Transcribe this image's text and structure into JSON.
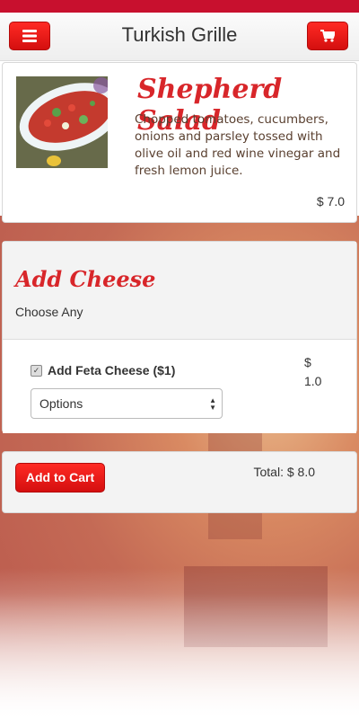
{
  "header": {
    "title": "Turkish Grille",
    "menu_icon": "hamburger-menu-icon",
    "cart_icon": "shopping-cart-icon",
    "accent_color": "#d40f0f"
  },
  "item": {
    "name": "Shepherd Salad",
    "description": "Chopped tomatoes, cucumbers, onions and parsley tossed with olive oil and red wine vinegar and fresh lemon juice.",
    "price": "$ 7.0"
  },
  "options": {
    "title": "Add Cheese",
    "subtitle": "Choose Any",
    "choices": [
      {
        "label": "Add Feta Cheese ($1)",
        "price": "$ 1.0",
        "checked": true,
        "select_value": "Options"
      }
    ]
  },
  "cart": {
    "add_button": "Add to Cart",
    "total": "Total: $ 8.0"
  }
}
